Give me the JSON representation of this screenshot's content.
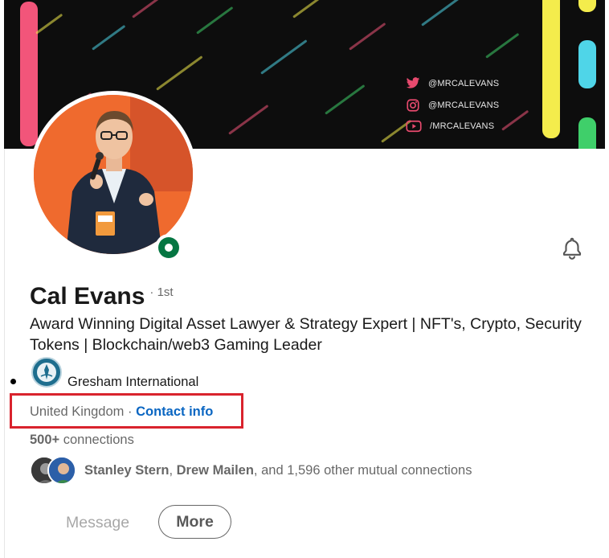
{
  "banner": {
    "socials": [
      {
        "icon": "twitter-icon",
        "handle": "@MRCALEVANS",
        "color": "#e84a6e"
      },
      {
        "icon": "instagram-icon",
        "handle": "@MRCALEVANS",
        "color": "#e84a6e"
      },
      {
        "icon": "youtube-icon",
        "handle": "/MRCALEVANS",
        "color": "#e84a6e"
      }
    ],
    "accent_colors": [
      "#f2557a",
      "#f4ec4c",
      "#4fd5e8",
      "#3fcf6a"
    ]
  },
  "profile": {
    "name": "Cal Evans",
    "degree": "· 1st",
    "headline": "Award Winning Digital Asset Lawyer & Strategy Expert | NFT's, Crypto, Security Tokens | Blockchain/web3 Gaming Leader",
    "company": "Gresham International",
    "location": "United Kingdom",
    "location_separator": " · ",
    "contact_info": "Contact info",
    "connections_count": "500+",
    "connections_label": " connections",
    "mutual": {
      "name1": "Stanley Stern",
      "sep": ", ",
      "name2": "Drew Mailen",
      "rest": ", and 1,596 other mutual connections"
    },
    "online_status_color": "#057642"
  },
  "actions": {
    "message": "Message",
    "more": "More"
  }
}
